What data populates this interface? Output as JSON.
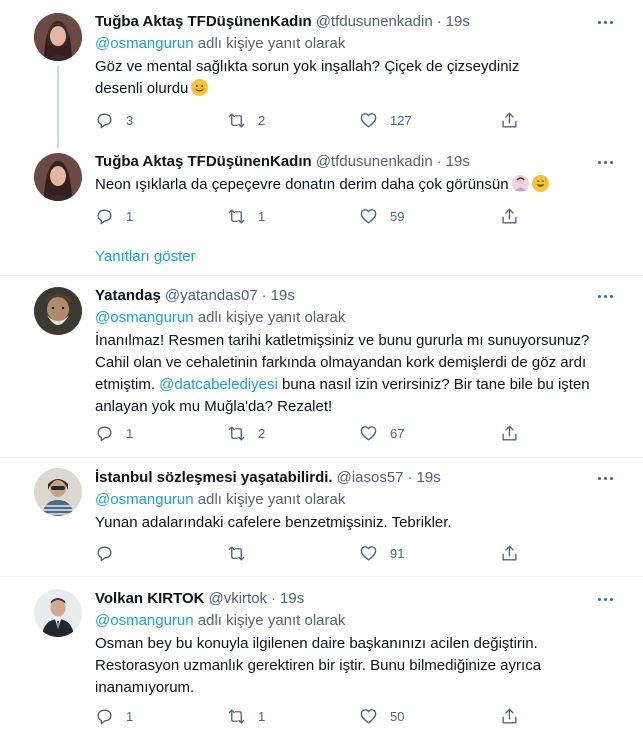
{
  "tweets": [
    {
      "name": "Tuğba Aktaş TFDüşünenKadın",
      "handle": "@tfdusunenkadin",
      "time": "19s",
      "reply_mention": "@osmangurun",
      "reply_suffix": " adlı kişiye yanıt olarak",
      "text": "Göz ve mental sağlıkta sorun yok inşallah? Çiçek de çizseydiniz desenli olurdu",
      "replies": "3",
      "retweets": "2",
      "likes": "127"
    },
    {
      "name": "Tuğba Aktaş TFDüşünenKadın",
      "handle": "@tfdusunenkadin",
      "time": "19s",
      "text": "Neon ışıklarla da çepeçevre donatın derim daha çok görünsün",
      "replies": "1",
      "retweets": "1",
      "likes": "59"
    },
    {
      "name": "Yatandaş",
      "handle": "@yatandas07",
      "time": "19s",
      "reply_mention": "@osmangurun",
      "reply_suffix": " adlı kişiye yanıt olarak",
      "text_a": "İnanılmaz! Resmen tarihi katletmişsiniz ve bunu gururla mı sunuyorsunuz? Cahil olan ve cehaletinin farkında olmayandan kork demişlerdi de göz ardı etmiştim. ",
      "text_mention": "@datcabelediyesi",
      "text_b": " buna nasıl izin verirsiniz? Bir tane bile bu işten anlayan yok mu Muğla'da? Rezalet!",
      "replies": "1",
      "retweets": "2",
      "likes": "67"
    },
    {
      "name": "İstanbul sözleşmesi yaşatabilirdi.",
      "handle": "@iasos57",
      "time": "19s",
      "reply_mention": "@osmangurun",
      "reply_suffix": " adlı kişiye yanıt olarak",
      "text": "Yunan adalarındaki cafelere benzetmişsiniz. Tebrikler.",
      "replies": "",
      "retweets": "",
      "likes": "91"
    },
    {
      "name": "Volkan KIRTOK",
      "handle": "@vkirtok",
      "time": "19s",
      "reply_mention": "@osmangurun",
      "reply_suffix": " adlı kişiye yanıt olarak",
      "text": "Osman bey bu konuyla ilgilenen daire başkanınızı acilen değiştirin. Restorasyon uzmanlık gerektiren bir iştir. Bunu bilmediğinize ayrıca inanamıyorum.",
      "replies": "1",
      "retweets": "1",
      "likes": "50"
    }
  ],
  "show_replies_label": "Yanıtları göster",
  "separator": "·",
  "colors": {
    "accent": "#1d9bf0",
    "secondary_text": "#536471",
    "divider": "#eff3f4"
  },
  "icons": [
    "reply-icon",
    "retweet-icon",
    "like-icon",
    "share-icon",
    "more-icon"
  ]
}
